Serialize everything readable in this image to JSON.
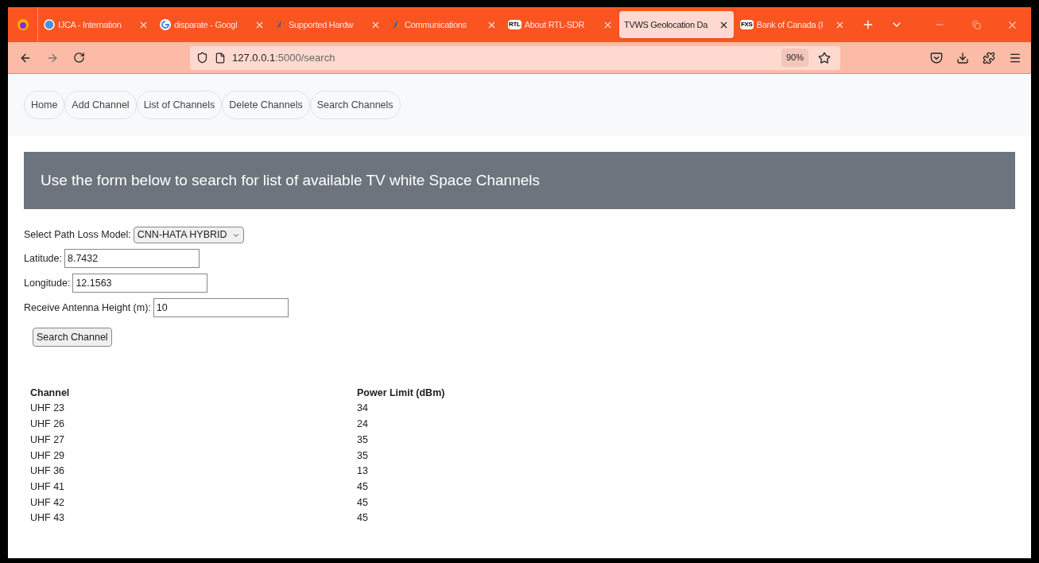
{
  "browser": {
    "tabs": [
      {
        "kind": "globe",
        "title": "IJCA - Internation",
        "selected": false
      },
      {
        "kind": "google",
        "title": "disparate - Googl",
        "selected": false
      },
      {
        "kind": "peak",
        "title": "Supported Hardw",
        "selected": false
      },
      {
        "kind": "peak",
        "title": "Communications",
        "selected": false
      },
      {
        "kind": "badge",
        "badge": "RTL",
        "title": "About RTL-SDR",
        "selected": false
      },
      {
        "kind": "plain",
        "title": "TVWS Geolocation Da",
        "selected": true
      },
      {
        "kind": "badge",
        "badge": "FXS",
        "title": "Bank of Canada (I",
        "selected": false
      }
    ],
    "url_host": "127.0.0.1",
    "url_path": ":5000/search",
    "zoom": "90%"
  },
  "nav": [
    "Home",
    "Add Channel",
    "List of Channels",
    "Delete Channels",
    "Search Channels"
  ],
  "banner": "Use the form below to search for list of available TV white Space Channels",
  "form": {
    "fields": [
      {
        "kind": "select",
        "label": "Select Path Loss Model:",
        "value": "CNN-HATA HYBRID"
      },
      {
        "kind": "input",
        "label": "Latitude:",
        "value": "8.7432"
      },
      {
        "kind": "input",
        "label": "Longitude:",
        "value": "12.1563"
      },
      {
        "kind": "input",
        "label": "Receive Antenna Height (m):",
        "value": "10"
      }
    ],
    "submit": "Search Channel"
  },
  "table": {
    "columns": [
      "Channel",
      "Power Limit (dBm)"
    ],
    "rows": [
      [
        "UHF 23",
        "34"
      ],
      [
        "UHF 26",
        "24"
      ],
      [
        "UHF 27",
        "35"
      ],
      [
        "UHF 29",
        "35"
      ],
      [
        "UHF 36",
        "13"
      ],
      [
        "UHF 41",
        "45"
      ],
      [
        "UHF 42",
        "45"
      ],
      [
        "UHF 43",
        "45"
      ]
    ]
  }
}
